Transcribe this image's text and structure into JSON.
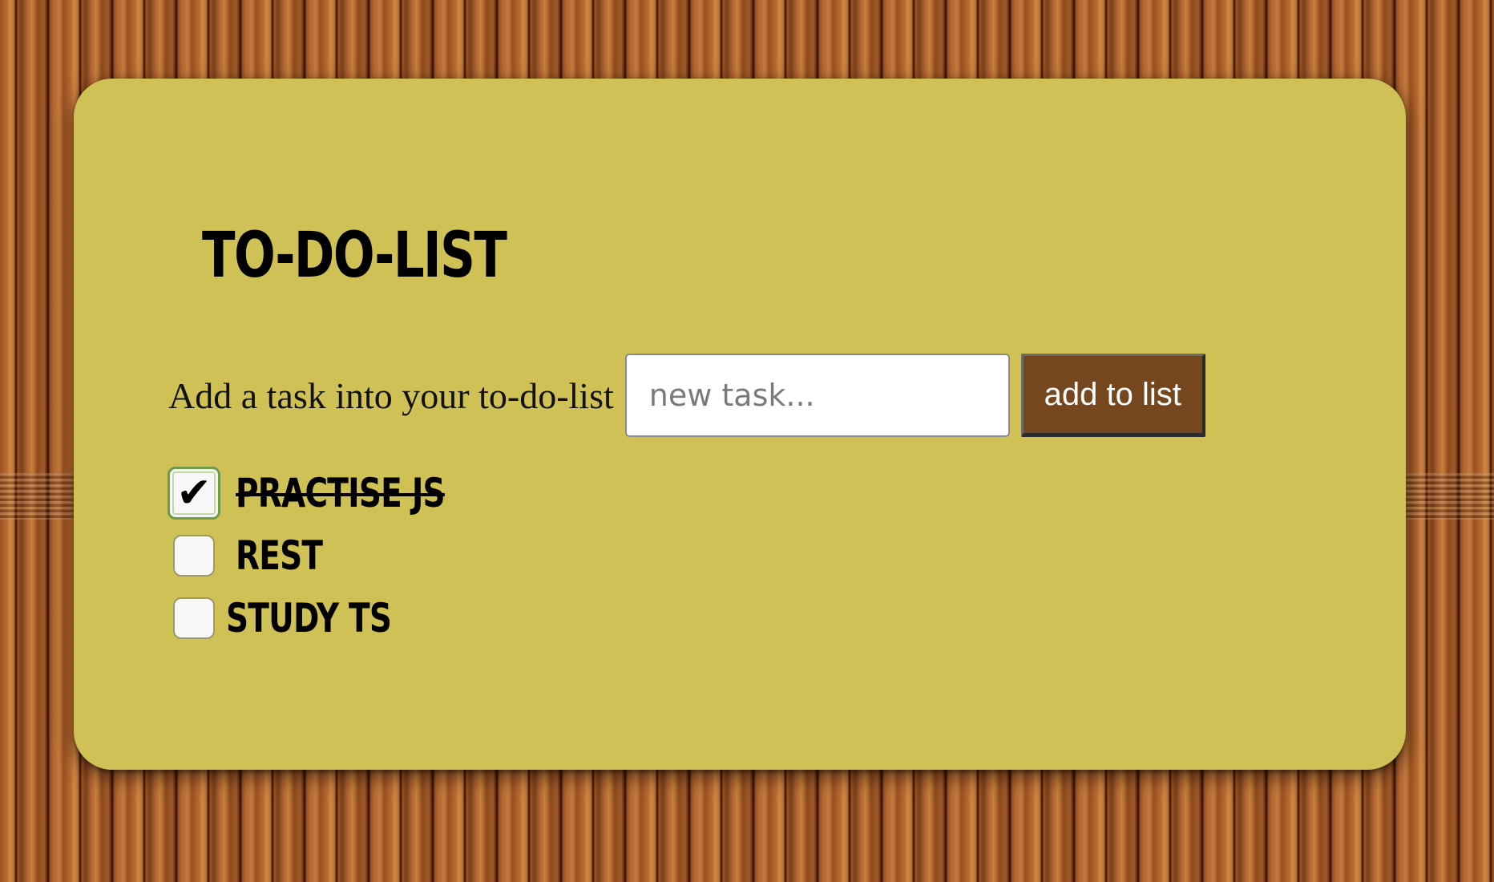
{
  "app": {
    "title": "TO-DO-LIST"
  },
  "add_form": {
    "label": "Add a task into your to-do-list",
    "input_placeholder": "new task...",
    "input_value": "",
    "button_label": "add to list"
  },
  "tasks": [
    {
      "text": "PRACTISE JS",
      "completed": true,
      "check_glyph": "✔"
    },
    {
      "text": "REST",
      "completed": false,
      "check_glyph": ""
    },
    {
      "text": "STUDY TS",
      "completed": false,
      "check_glyph": ""
    }
  ],
  "colors": {
    "card_background": "#cfc155",
    "button_background": "#76471f",
    "text": "#000000"
  },
  "icons": {
    "checkmark": "heavy-check-mark"
  }
}
